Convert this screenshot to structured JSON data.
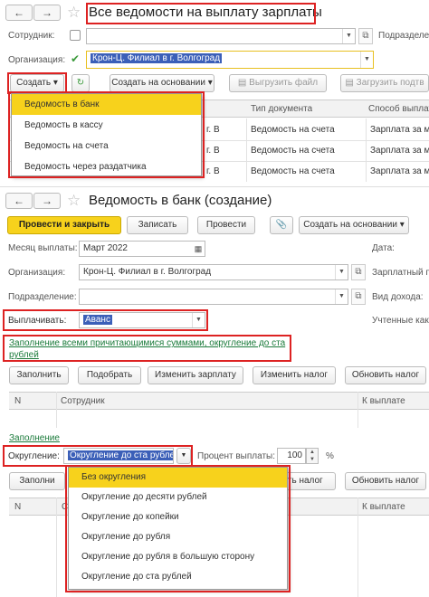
{
  "top_window": {
    "title": "Все ведомости на выплату зарплаты",
    "nav_back": "←",
    "nav_forward": "→",
    "star": "☆",
    "employee_label": "Сотрудник:",
    "subdivision_label": "Подразделе",
    "org_label": "Организация:",
    "org_value": "Крон-Ц. Филиал в г. Волгоград",
    "create_button": "Создать",
    "create_based_button": "Создать на основании",
    "export_button": "Выгрузить файл",
    "import_button": "Загрузить подтв",
    "table": {
      "headers": [
        "Тип документа",
        "Способ выплат"
      ],
      "rows": [
        {
          "prefix": "г. В",
          "type": "Ведомость на счета",
          "method": "Зарплата за м"
        },
        {
          "prefix": "г. В",
          "type": "Ведомость на счета",
          "method": "Зарплата за м"
        },
        {
          "prefix": "г. В",
          "type": "Ведомость на счета",
          "method": "Зарплата за м"
        }
      ]
    },
    "create_menu": [
      "Ведомость в банк",
      "Ведомость в кассу",
      "Ведомость на счета",
      "Ведомость через раздатчика"
    ]
  },
  "doc_window": {
    "title": "Ведомость в банк (создание)",
    "nav_back": "←",
    "nav_forward": "→",
    "star": "☆",
    "post_close_button": "Провести и закрыть",
    "save_button": "Записать",
    "post_button": "Провести",
    "attach_icon": "📎",
    "create_based_button": "Создать на основании",
    "month_label": "Месяц выплаты:",
    "month_value": "Март 2022",
    "date_label": "Дата:",
    "org_label": "Организация:",
    "org_value": "Крон-Ц. Филиал в г. Волгоград",
    "salary_project_label": "Зарплатный п",
    "subdivision_label": "Подразделение:",
    "income_type_label": "Вид дохода:",
    "pay_label": "Выплачивать:",
    "pay_value": "Аванс",
    "accounted_label": "Учтенные как",
    "fill_link": "Заполнение всеми причитающимися суммами, округление до ста рублей",
    "fill_button": "Заполнить",
    "pick_button": "Подобрать",
    "change_salary_button": "Изменить зарплату",
    "change_tax_button": "Изменить налог",
    "refresh_tax_button": "Обновить налог",
    "table_headers": [
      "N",
      "Сотрудник",
      "К выплате"
    ],
    "fill_link2": "Заполнение",
    "rounding_label": "Округление:",
    "rounding_value": "Округление до ста рублей",
    "percent_label": "Процент выплаты:",
    "percent_value": "100",
    "percent_sign": "%",
    "rounding_menu": [
      "Без округления",
      "Округление до десяти рублей",
      "Округление до копейки",
      "Округление до рубля",
      "Округление до рубля в большую сторону",
      "Округление до ста рублей"
    ],
    "bottom_fill_button": "Заполни",
    "bottom_change_tax_button": "ить налог",
    "bottom_refresh_tax_button": "Обновить налог",
    "bottom_headers": [
      "N",
      "С",
      "К выплате"
    ]
  }
}
